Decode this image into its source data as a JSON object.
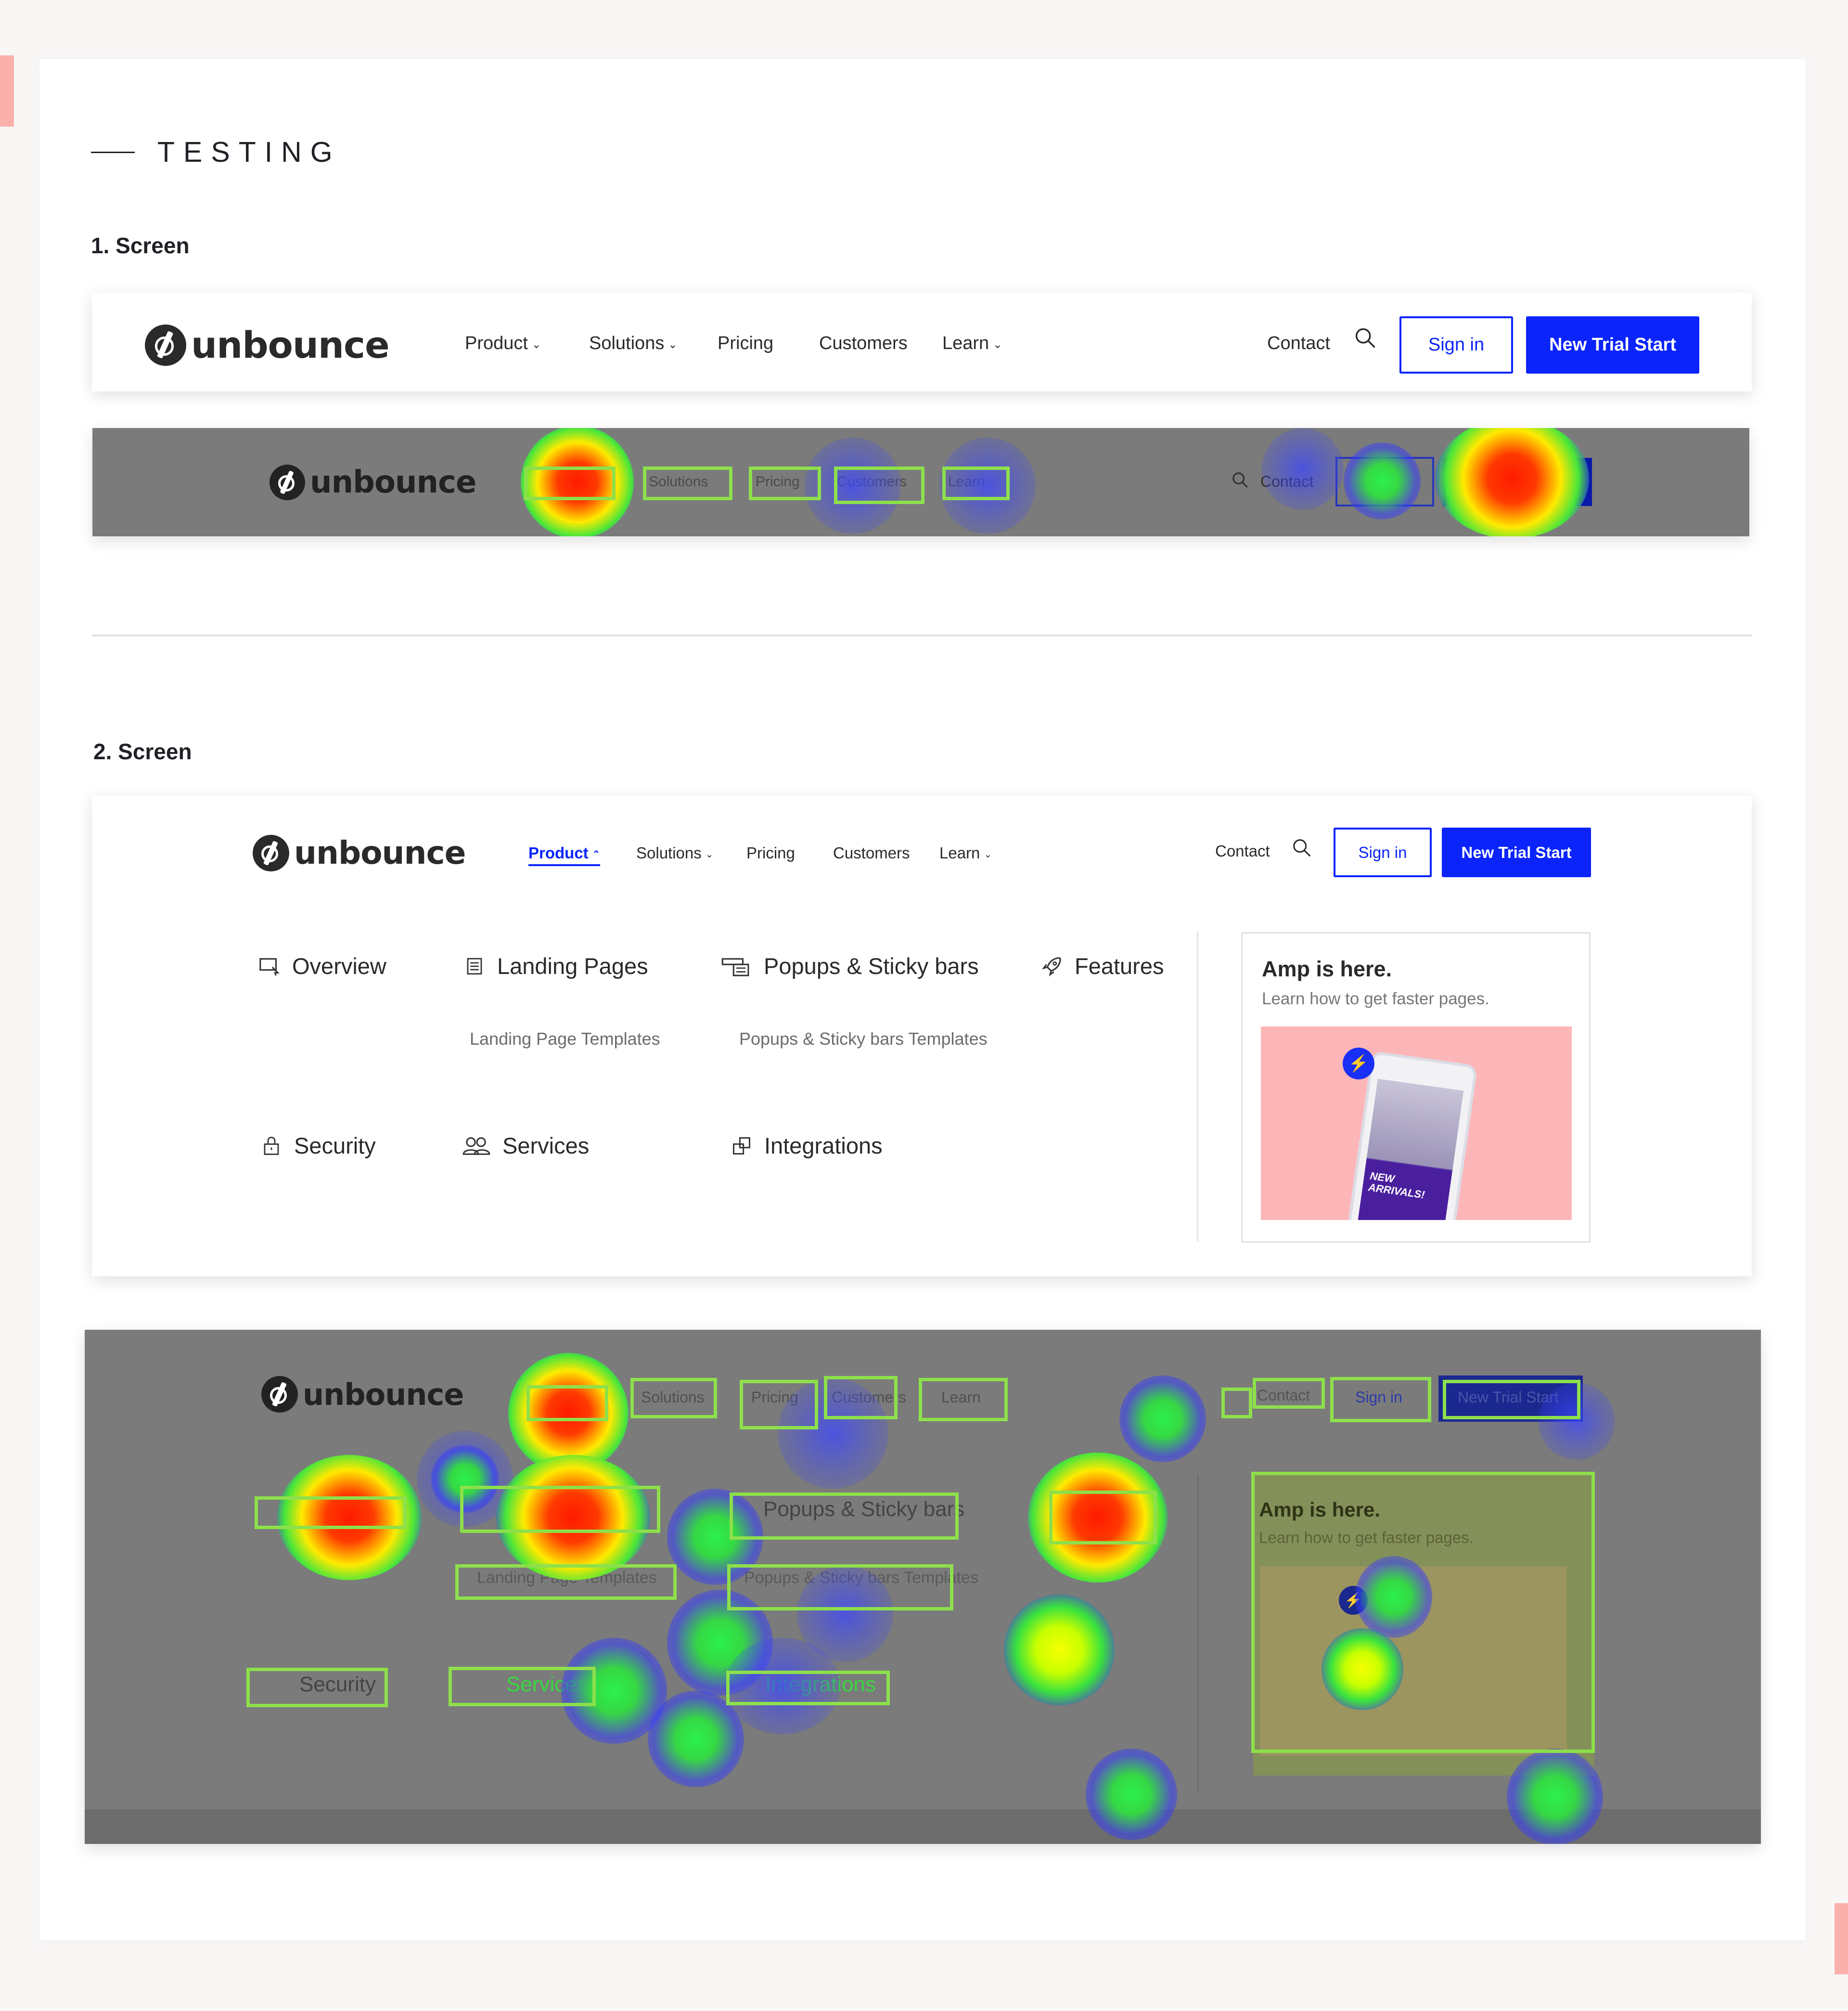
{
  "section": {
    "title": "TESTING"
  },
  "screen1": {
    "label": "1. Screen"
  },
  "screen2": {
    "label": "2. Screen"
  },
  "brand": {
    "name": "unbounce",
    "accent": "#0b24fb",
    "heat_box": "#8de04b",
    "page_accent": "#fbb1ab"
  },
  "nav": {
    "product": "Product",
    "solutions": "Solutions",
    "pricing": "Pricing",
    "customers": "Customers",
    "learn": "Learn",
    "contact": "Contact",
    "sign_in": "Sign in",
    "new_trial": "New Trial Start"
  },
  "menu": {
    "overview": "Overview",
    "landing_pages": "Landing Pages",
    "landing_templates": "Landing  Page Templates",
    "popups": "Popups & Sticky bars",
    "popups_templates": "Popups & Sticky bars Templates",
    "features": "Features",
    "security": "Security",
    "services": "Services",
    "integrations": "Integrations"
  },
  "promo": {
    "title": "Amp is here.",
    "subtitle": "Learn how to get faster pages.",
    "image_text": "NEW ARRIVALS!"
  },
  "icons": [
    "search-icon",
    "chevron-down-icon",
    "chevron-up-icon",
    "overview-icon",
    "landing-pages-icon",
    "popups-icon",
    "rocket-icon",
    "lock-icon",
    "users-icon",
    "integrations-icon",
    "bolt-icon"
  ]
}
